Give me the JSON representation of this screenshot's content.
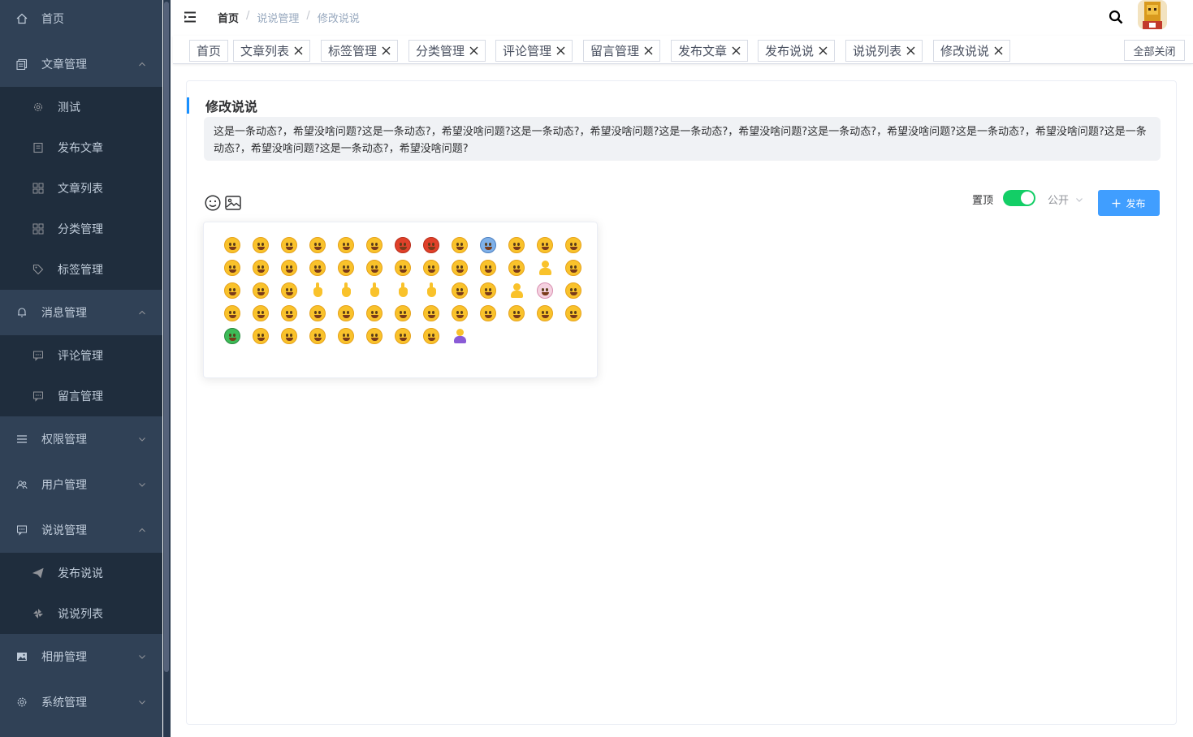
{
  "sidebar": {
    "items": [
      {
        "label": "首页",
        "icon": "home-icon"
      },
      {
        "label": "文章管理",
        "icon": "document-icon",
        "children": [
          {
            "label": "测试",
            "icon": "gear-icon"
          },
          {
            "label": "发布文章",
            "icon": "edit-icon"
          },
          {
            "label": "文章列表",
            "icon": "grid-icon"
          },
          {
            "label": "分类管理",
            "icon": "grid-icon"
          },
          {
            "label": "标签管理",
            "icon": "tag-icon"
          }
        ]
      },
      {
        "label": "消息管理",
        "icon": "bell-icon",
        "children": [
          {
            "label": "评论管理",
            "icon": "message-icon"
          },
          {
            "label": "留言管理",
            "icon": "message-icon"
          }
        ]
      },
      {
        "label": "权限管理",
        "icon": "menu-icon"
      },
      {
        "label": "用户管理",
        "icon": "users-icon"
      },
      {
        "label": "说说管理",
        "icon": "chat-icon",
        "children": [
          {
            "label": "发布说说",
            "icon": "send-icon"
          },
          {
            "label": "说说列表",
            "icon": "pinwheel-icon"
          }
        ]
      },
      {
        "label": "相册管理",
        "icon": "picture-icon"
      },
      {
        "label": "系统管理",
        "icon": "settings-icon"
      }
    ]
  },
  "header": {
    "breadcrumb": [
      "首页",
      "说说管理",
      "修改说说"
    ],
    "separator": "/"
  },
  "tags": {
    "items": [
      "首页",
      "文章列表",
      "标签管理",
      "分类管理",
      "评论管理",
      "留言管理",
      "发布文章",
      "发布说说",
      "说说列表",
      "修改说说"
    ],
    "close_all": "全部关闭"
  },
  "main": {
    "title": "修改说说",
    "content": "这是一条动态?，希望没啥问题?这是一条动态?，希望没啥问题?这是一条动态?，希望没啥问题?这是一条动态?，希望没啥问题?这是一条动态?，希望没啥问题?这是一条动态?，希望没啥问题?这是一条动态?，希望没啥问题?这是一条动态?，希望没啥问题?",
    "top_label": "置顶",
    "top_enabled": true,
    "visibility": "公开",
    "publish_label": "发布",
    "colors": {
      "accent": "#409eff",
      "switch_on": "#13ce66",
      "sidebar_bg": "#304156"
    }
  },
  "emoji_picker": {
    "count": 61
  }
}
